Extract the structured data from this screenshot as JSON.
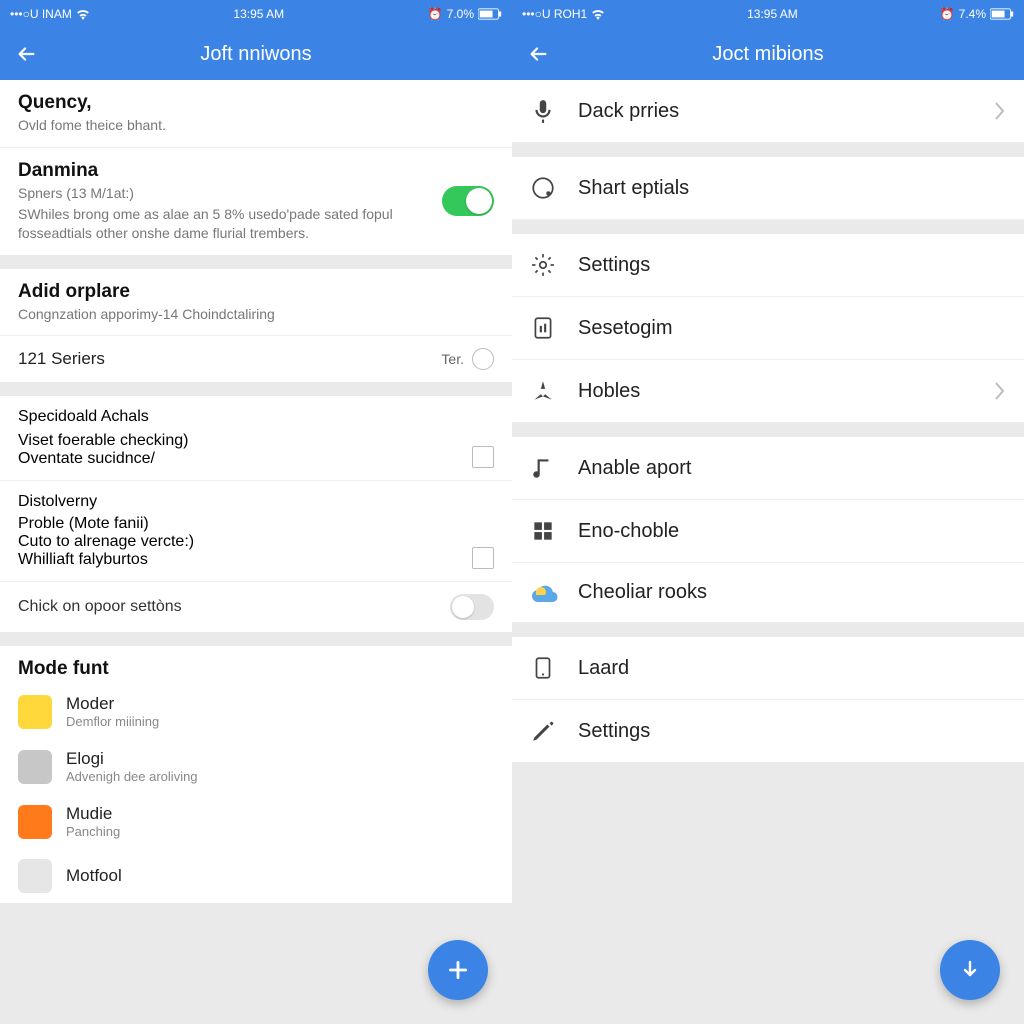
{
  "left": {
    "status": {
      "carrier": "•••○U  INAM",
      "wifi": "wifi",
      "time": "13:95 AM",
      "battery": "7.0%"
    },
    "header": {
      "title": "Joft nniwons"
    },
    "sec1": {
      "quency_title": "Quency,",
      "quency_sub": "Ovld fome theice bhant.",
      "danmina_title": "Danmina",
      "danmina_sub1": "Spners (13 M/1at:)",
      "danmina_sub2": "SWhiles brong ome as alae an 5 8% usedo'pade sated fopul fosseadtials other onshe dame flurial trembers."
    },
    "sec2": {
      "adid_title": "Adid orplare",
      "adid_sub": "Congnzation apporimy-14 Choindctaliring",
      "seriers_title": "121 Seriers",
      "seriers_right": "Ter."
    },
    "sec3": {
      "spec_title": "Specidoald Achals",
      "spec_line1": "Viset foerable checking)",
      "spec_line2": "Oventate sucidnce/",
      "dist_title": "Distolverny",
      "dist_sub1": "Proble (Mote fanii)",
      "dist_sub2": "Cuto to alrenage vercte:)",
      "dist_sub3": "Whilliaft falyburtos",
      "chick": "Chick on opoor settòns"
    },
    "sec4": {
      "header": "Mode funt",
      "apps": [
        {
          "name": "Moder",
          "sub": "Demflor miiining",
          "color": "#ffd93b"
        },
        {
          "name": "Elogi",
          "sub": "Advenigh dee aroliving",
          "color": "#c7c7c7"
        },
        {
          "name": "Mudie",
          "sub": "Panching",
          "color": "#ff7a1a"
        },
        {
          "name": "Motfool",
          "sub": "",
          "color": "#e6e6e6"
        }
      ]
    }
  },
  "right": {
    "status": {
      "carrier": "•••○U  ROH1",
      "wifi": "wifi",
      "time": "13:95 AM",
      "battery": "7.4%"
    },
    "header": {
      "title": "Joct mibions"
    },
    "items": [
      {
        "icon": "mic",
        "label": "Dack prries",
        "chev": true
      },
      {
        "icon": "circle",
        "label": "Shart eptials",
        "chev": false
      },
      {
        "icon": "gear",
        "label": "Settings",
        "chev": false
      },
      {
        "icon": "doc-bars",
        "label": "Sesetogim",
        "chev": false
      },
      {
        "icon": "star3",
        "label": "Hobles",
        "chev": true
      },
      {
        "icon": "music",
        "label": "Anable aport",
        "chev": false
      },
      {
        "icon": "grid",
        "label": "Eno-choble",
        "chev": false
      },
      {
        "icon": "cloud",
        "label": "Cheoliar rooks",
        "chev": false
      },
      {
        "icon": "page",
        "label": "Laard",
        "chev": false
      },
      {
        "icon": "pencil",
        "label": "Settings",
        "chev": false
      }
    ]
  }
}
